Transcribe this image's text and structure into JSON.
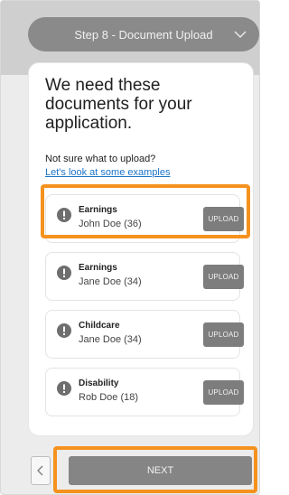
{
  "header": {
    "step_label": "Step 8 - Document Upload"
  },
  "card": {
    "title": "We need these documents for your application.",
    "unsure_text": "Not sure what to upload?",
    "examples_link": "Let's look at some examples"
  },
  "documents": [
    {
      "title": "Earnings",
      "person": "John Doe (36)",
      "button": "UPLOAD"
    },
    {
      "title": "Earnings",
      "person": "Jane Doe (34)",
      "button": "UPLOAD"
    },
    {
      "title": "Childcare",
      "person": "Jane Doe (34)",
      "button": "UPLOAD"
    },
    {
      "title": "Disability",
      "person": "Rob Doe (18)",
      "button": "UPLOAD"
    }
  ],
  "nav": {
    "next_label": "NEXT"
  },
  "colors": {
    "highlight": "#f5921e",
    "button_gray": "#7d7d7d",
    "link": "#1a73c8"
  }
}
